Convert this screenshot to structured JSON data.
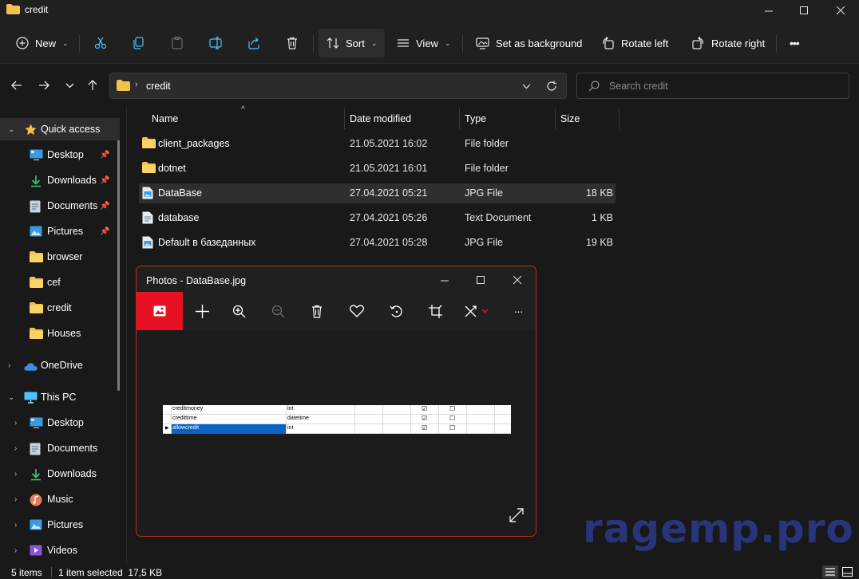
{
  "window": {
    "title": "credit",
    "controls": [
      "minimize",
      "maximize",
      "close"
    ]
  },
  "command_bar": {
    "new_label": "New",
    "sort_label": "Sort",
    "view_label": "View",
    "set_background_label": "Set as background",
    "rotate_left_label": "Rotate left",
    "rotate_right_label": "Rotate right",
    "more_label": "•••"
  },
  "address": {
    "path": "credit",
    "search_placeholder": "Search credit"
  },
  "sidebar": {
    "quick_access": "Quick access",
    "quick_items": [
      {
        "label": "Desktop",
        "icon": "desktop-icon",
        "pinned": true
      },
      {
        "label": "Downloads",
        "icon": "download-icon",
        "pinned": true
      },
      {
        "label": "Documents",
        "icon": "document-icon",
        "pinned": true
      },
      {
        "label": "Pictures",
        "icon": "picture-icon",
        "pinned": true
      },
      {
        "label": "browser",
        "icon": "folder-icon",
        "pinned": false
      },
      {
        "label": "cef",
        "icon": "folder-icon",
        "pinned": false
      },
      {
        "label": "credit",
        "icon": "folder-icon",
        "pinned": false
      },
      {
        "label": "Houses",
        "icon": "folder-icon",
        "pinned": false
      }
    ],
    "onedrive": "OneDrive",
    "this_pc": "This PC",
    "pc_items": [
      {
        "label": "Desktop",
        "icon": "desktop-icon"
      },
      {
        "label": "Documents",
        "icon": "document-icon"
      },
      {
        "label": "Downloads",
        "icon": "download-icon"
      },
      {
        "label": "Music",
        "icon": "music-icon"
      },
      {
        "label": "Pictures",
        "icon": "picture-icon"
      },
      {
        "label": "Videos",
        "icon": "video-icon"
      }
    ]
  },
  "file_list": {
    "columns": {
      "name": "Name",
      "date": "Date modified",
      "type": "Type",
      "size": "Size"
    },
    "rows": [
      {
        "name": "client_packages",
        "date": "21.05.2021 16:02",
        "type": "File folder",
        "size": "",
        "icon": "folder-icon"
      },
      {
        "name": "dotnet",
        "date": "21.05.2021 16:01",
        "type": "File folder",
        "size": "",
        "icon": "folder-icon"
      },
      {
        "name": "DataBase",
        "date": "27.04.2021 05:21",
        "type": "JPG File",
        "size": "18 KB",
        "icon": "image-file-icon",
        "selected": true
      },
      {
        "name": "database",
        "date": "27.04.2021 05:26",
        "type": "Text Document",
        "size": "1 KB",
        "icon": "text-file-icon"
      },
      {
        "name": "Default в базеданных",
        "date": "27.04.2021 05:28",
        "type": "JPG File",
        "size": "19 KB",
        "icon": "image-file-icon"
      }
    ]
  },
  "status_bar": {
    "items_count": "5 items",
    "selection": "1 item selected  17,5 KB"
  },
  "photos_window": {
    "title": "Photos - DataBase.jpg",
    "image_rows": [
      {
        "col1": "creditmoney",
        "col2": "int",
        "c1": "☑",
        "c2": "☐"
      },
      {
        "col1": "credittime",
        "col2": "datetime",
        "c1": "☑",
        "c2": "☐"
      },
      {
        "col1": "allowcredit",
        "col2": "int",
        "c1": "☑",
        "c2": "☐"
      }
    ]
  },
  "watermark": "ragemp.pro"
}
